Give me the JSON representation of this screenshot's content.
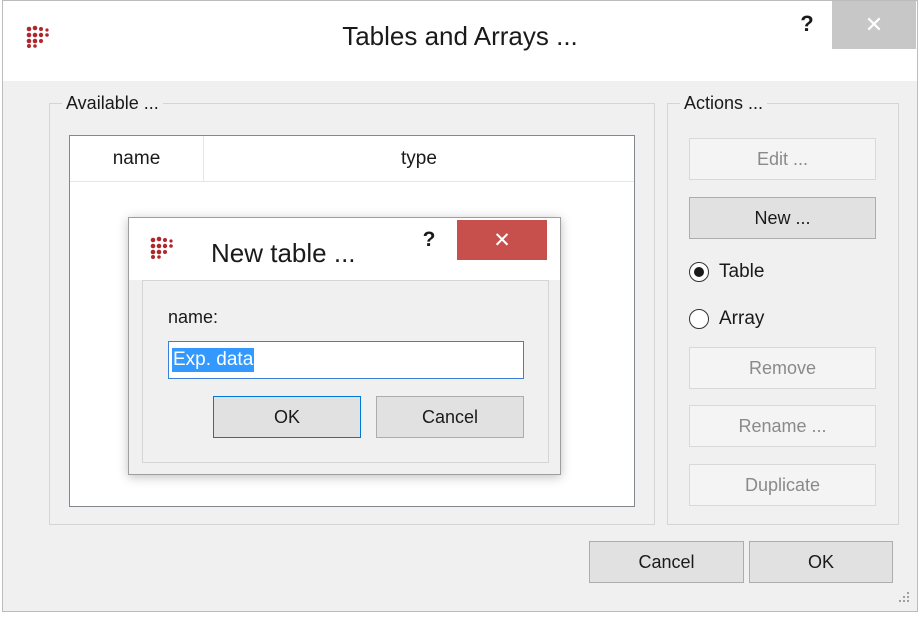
{
  "window": {
    "title": "Tables and Arrays ...",
    "help_glyph": "?",
    "close_glyph": "✕"
  },
  "available": {
    "legend": "Available ...",
    "columns": [
      "name",
      "type"
    ]
  },
  "actions": {
    "legend": "Actions ...",
    "edit_label": "Edit ...",
    "new_label": "New ...",
    "radio_table_label": "Table",
    "radio_array_label": "Array",
    "selected_type": "Table",
    "remove_label": "Remove",
    "rename_label": "Rename ...",
    "duplicate_label": "Duplicate"
  },
  "footer": {
    "cancel_label": "Cancel",
    "ok_label": "OK"
  },
  "dialog": {
    "title": "New table ...",
    "help_glyph": "?",
    "close_glyph": "✕",
    "name_label": "name:",
    "name_value": "Exp. data",
    "ok_label": "OK",
    "cancel_label": "Cancel"
  },
  "colors": {
    "dialog_close_bg": "#c8504c",
    "selection": "#3399ff",
    "icon_red": "#b0262b"
  },
  "icons": {
    "app": "dots-cluster-icon",
    "grip": "resize-grip-icon"
  }
}
